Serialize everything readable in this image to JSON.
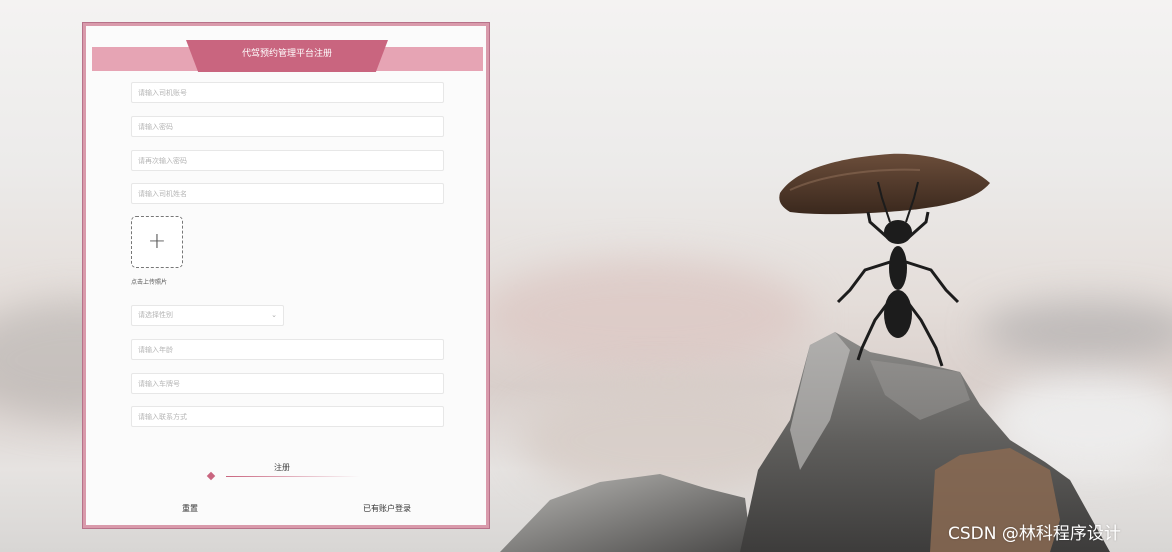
{
  "colors": {
    "accent": "#c9657f",
    "accent_light": "#e6a4b4",
    "panel_border": "#d99aab"
  },
  "form": {
    "title": "代驾预约管理平台注册",
    "fields": {
      "account_placeholder": "请输入司机账号",
      "password_placeholder": "请输入密码",
      "confirm_password_placeholder": "请再次输入密码",
      "name_placeholder": "请输入司机姓名",
      "age_placeholder": "请输入年龄",
      "plate_placeholder": "请输入车牌号",
      "contact_placeholder": "请输入联系方式"
    },
    "upload": {
      "icon": "plus-icon",
      "plus": "+",
      "label": "点击上传照片"
    },
    "gender_select": {
      "placeholder": "请选择性别",
      "arrow": "⌄"
    },
    "register_label": "注册",
    "reset_label": "重置",
    "login_label": "已有账户登录"
  },
  "watermark": "CSDN @林科程序设计"
}
